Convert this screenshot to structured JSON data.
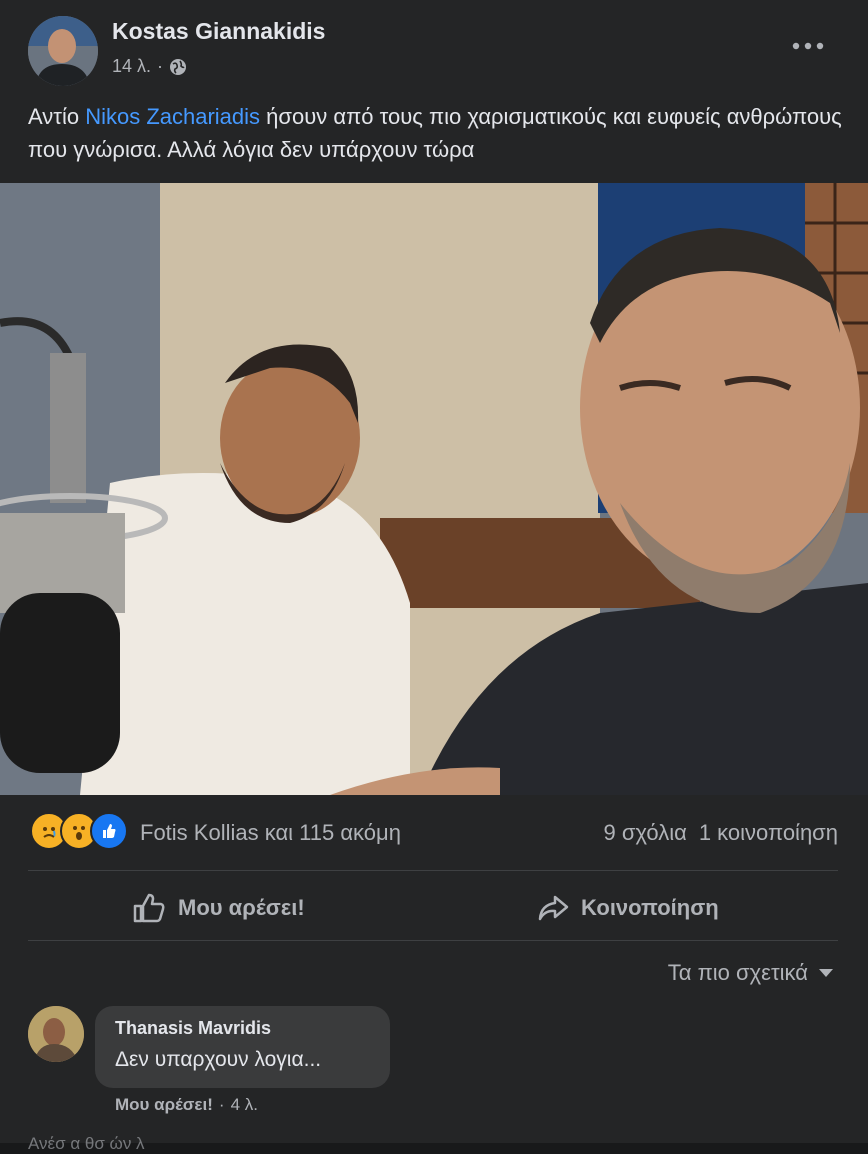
{
  "post": {
    "author": "Kostas Giannakidis",
    "time": "14 λ.",
    "separator": "·",
    "text_before": "Αντίο ",
    "mention": "Nikos Zachariadis",
    "text_after": " ήσουν από τους πιο χαρισματικούς και ευφυείς ανθρώπους που γνώρισα. Αλλά λόγια δεν υπάρχουν τώρα"
  },
  "reactions": {
    "icons": [
      "sad-icon",
      "wow-icon",
      "like-icon"
    ],
    "names": "Fotis Kollias και 115 ακόμη",
    "comments": "9 σχόλια",
    "shares": "1 κοινοποίηση"
  },
  "actions": {
    "like": "Μου αρέσει!",
    "share": "Κοινοποίηση"
  },
  "sort": {
    "label": "Τα πιο σχετικά"
  },
  "comment": {
    "author": "Thanasis Mavridis",
    "text": "Δεν υπαρχουν λογια...",
    "like": "Μου αρέσει!",
    "separator": "·",
    "time": "4 λ."
  },
  "cut_text": "Ανέσ α θσ ών  λ",
  "colors": {
    "background": "#242526",
    "mention": "#4599ff",
    "like_reaction": "#1877f2",
    "sad_reaction": "#f7b125"
  }
}
